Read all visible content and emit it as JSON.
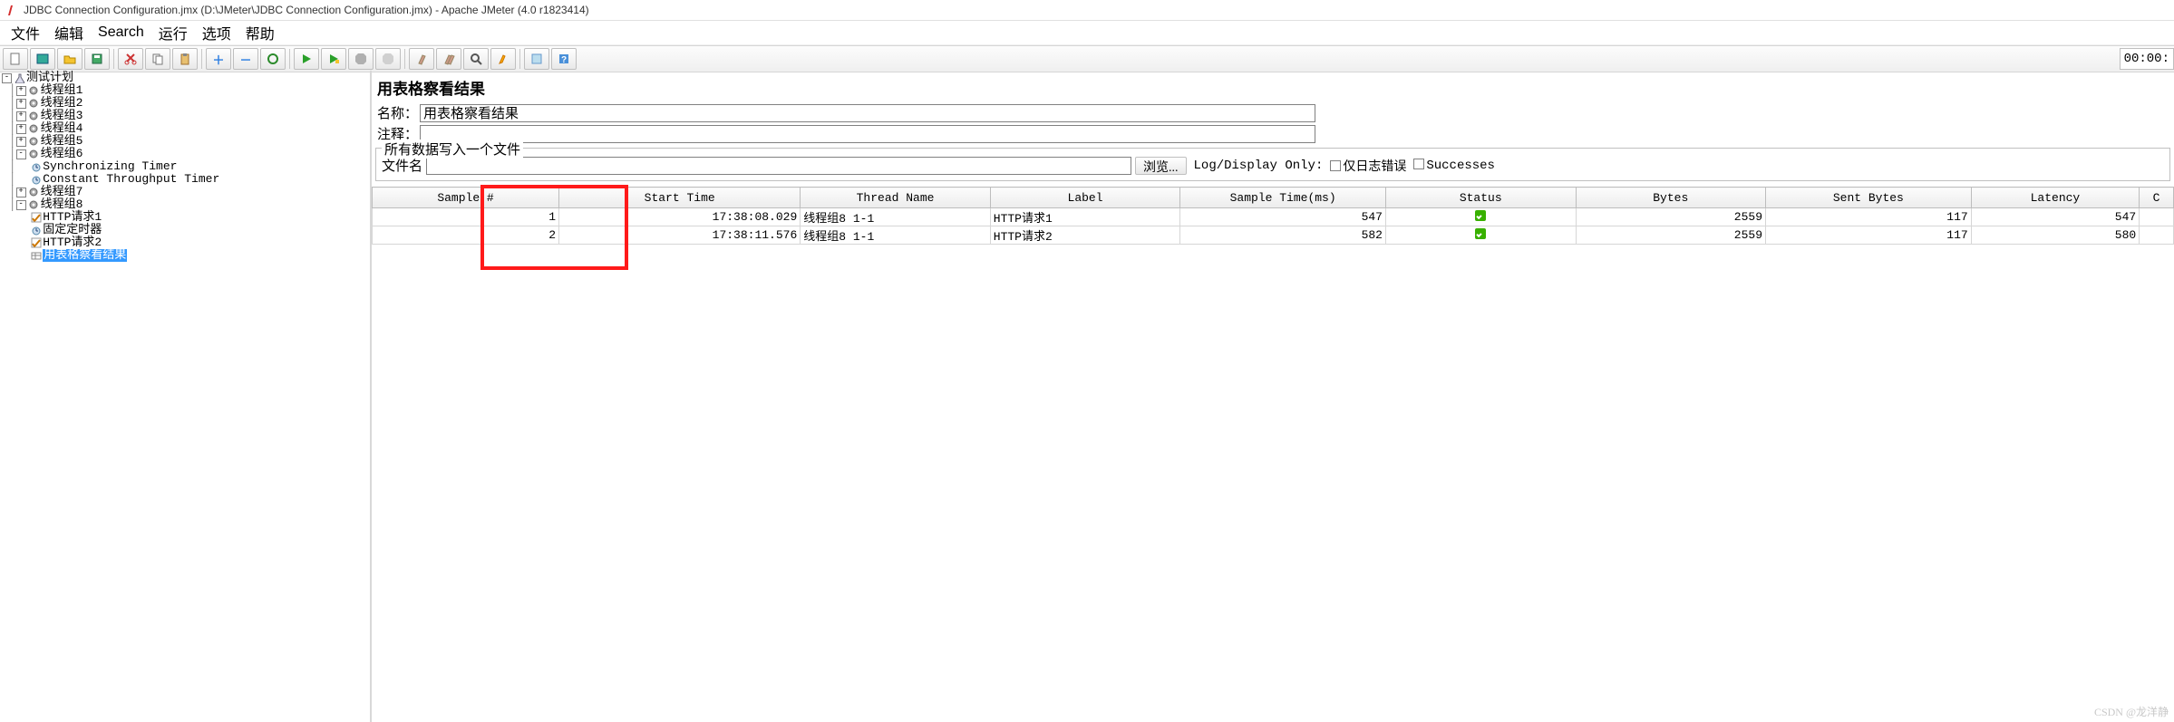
{
  "window_title": "JDBC Connection Configuration.jmx (D:\\JMeter\\JDBC Connection Configuration.jmx) - Apache JMeter (4.0 r1823414)",
  "menu": [
    "文件",
    "编辑",
    "Search",
    "运行",
    "选项",
    "帮助"
  ],
  "toolbar_time": "00:00:",
  "tree": {
    "root": "测试计划",
    "groups": [
      {
        "label": "线程组1",
        "expanded": false
      },
      {
        "label": "线程组2",
        "expanded": false
      },
      {
        "label": "线程组3",
        "expanded": false
      },
      {
        "label": "线程组4",
        "expanded": false
      },
      {
        "label": "线程组5",
        "expanded": false
      },
      {
        "label": "线程组6",
        "expanded": true,
        "children": [
          {
            "label": "Synchronizing Timer",
            "kind": "timer"
          },
          {
            "label": "Constant Throughput Timer",
            "kind": "timer"
          }
        ]
      },
      {
        "label": "线程组7",
        "expanded": false
      },
      {
        "label": "线程组8",
        "expanded": true,
        "children": [
          {
            "label": "HTTP请求1",
            "kind": "sampler"
          },
          {
            "label": "固定定时器",
            "kind": "timer"
          },
          {
            "label": "HTTP请求2",
            "kind": "sampler"
          },
          {
            "label": "用表格察看结果",
            "kind": "listener",
            "selected": true
          }
        ]
      }
    ]
  },
  "panel": {
    "title": "用表格察看结果",
    "name_label": "名称：",
    "name_value": "用表格察看结果",
    "comment_label": "注释：",
    "comment_value": "",
    "file_group_legend": "所有数据写入一个文件",
    "file_label": "文件名",
    "file_value": "",
    "browse_label": "浏览...",
    "log_display_label": "Log/Display Only:",
    "chk_errors": "仅日志错误",
    "chk_success": "Successes"
  },
  "table": {
    "headers": [
      "Sample #",
      "Start Time",
      "Thread Name",
      "Label",
      "Sample Time(ms)",
      "Status",
      "Bytes",
      "Sent Bytes",
      "Latency",
      "C"
    ],
    "rows": [
      {
        "n": 1,
        "start": "17:38:08.029",
        "thread": "线程组8 1-1",
        "label": "HTTP请求1",
        "time": 547,
        "status": "ok",
        "bytes": 2559,
        "sent": 117,
        "latency": 547
      },
      {
        "n": 2,
        "start": "17:38:11.576",
        "thread": "线程组8 1-1",
        "label": "HTTP请求2",
        "time": 582,
        "status": "ok",
        "bytes": 2559,
        "sent": 117,
        "latency": 580
      }
    ]
  },
  "watermark": "CSDN @龙洋静"
}
